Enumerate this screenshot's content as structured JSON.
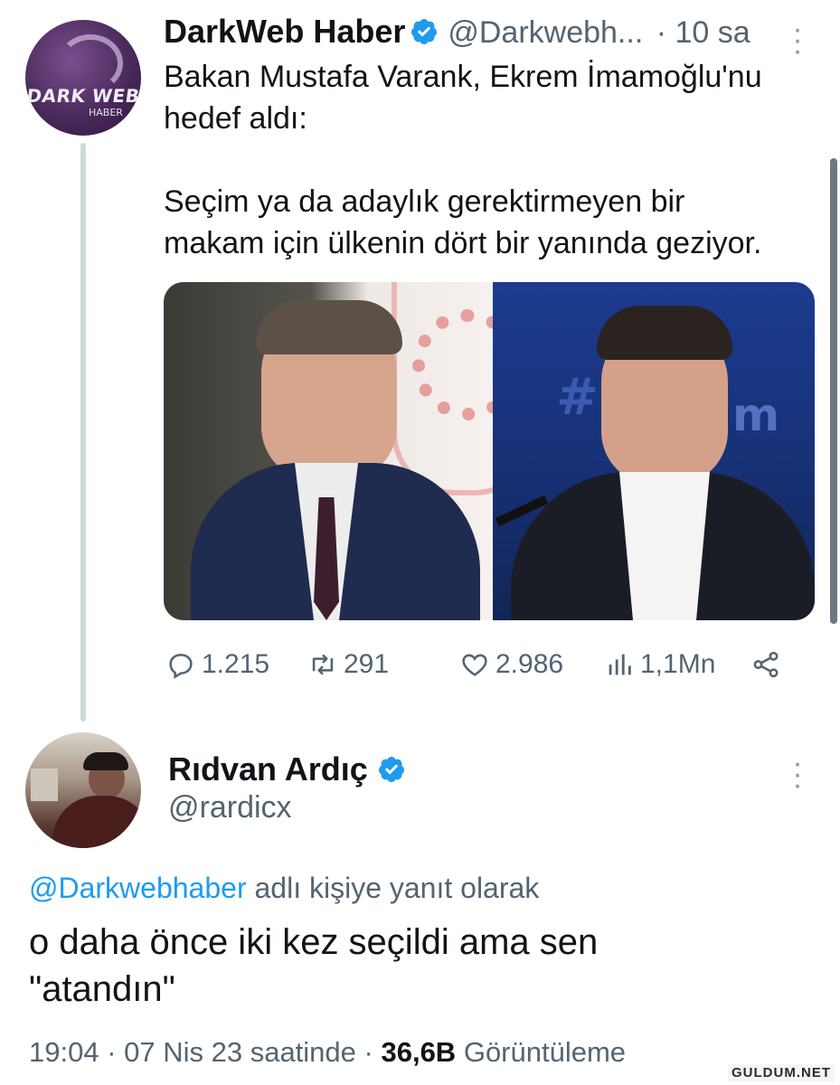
{
  "tweet": {
    "author_name": "DarkWeb Haber",
    "author_handle": "@Darkwebh...",
    "time": "· 10 sa",
    "avatar_text_line1": "DARK WEB",
    "avatar_text_line2": "HABER",
    "text": "Bakan Mustafa Varank, Ekrem İmamoğlu'nu\nhedef aldı:\n\nSeçim ya da adaylık gerektirmeyen bir\nmakam için ülkenin dört bir yanında geziyor.",
    "stats": {
      "replies": "1.215",
      "retweets": "291",
      "likes": "2.986",
      "views": "1,1Mn"
    }
  },
  "reply": {
    "author_name": "Rıdvan Ardıç",
    "author_handle": "@rardicx",
    "replying_to_mention": "@Darkwebhaber",
    "replying_to_suffix": "adlı kişiye yanıt olarak",
    "text": "o daha önce iki kez seçildi ama sen\n\"atandın\"",
    "time": "19:04 · 07 Nis 23 saatinde ·",
    "views_count": "36,6B",
    "views_label": "Görüntüleme"
  },
  "watermark": "GULDUM.NET",
  "colors": {
    "accent": "#1d9bf0",
    "text": "#0f1419",
    "secondary": "#536471",
    "thread_line": "#cfd9de"
  }
}
